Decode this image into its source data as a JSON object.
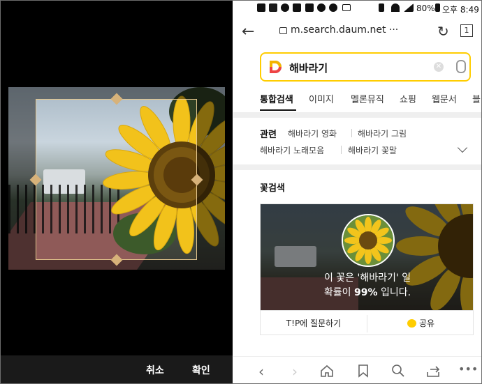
{
  "left_panel": {
    "cancel_label": "취소",
    "confirm_label": "확인"
  },
  "status_bar": {
    "battery": "80%",
    "time": "오후 8:49"
  },
  "browser": {
    "url": "m.search.daum.net ···",
    "tab_count": "1"
  },
  "search": {
    "query": "해바라기"
  },
  "category_tabs": [
    "통합검색",
    "이미지",
    "멜론뮤직",
    "쇼핑",
    "웹문서",
    "블"
  ],
  "related": {
    "label": "관련",
    "items": [
      "해바라기 영화",
      "해바라기 그림",
      "해바라기 노래모음",
      "해바라기 꽃말"
    ]
  },
  "flower_search": {
    "title": "꽃검색",
    "line1": "이 꽃은 '해바라기' 일",
    "line2_prefix": "확률이 ",
    "line2_percent": "99%",
    "line2_suffix": " 입니다.",
    "ask_button": "T!P에 질문하기",
    "share_button": "공유"
  },
  "colors": {
    "accent_yellow": "#ffcd00",
    "crop_handle": "#d7b27a"
  }
}
